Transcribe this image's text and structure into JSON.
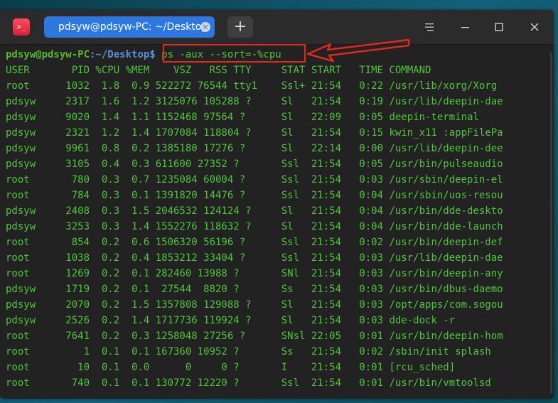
{
  "window": {
    "app_icon_glyph": ">_",
    "tab_title": "pdsyw@pdsyw-PC: ~/Desktop",
    "tab_close_glyph": "×",
    "add_tab_glyph": "+",
    "icons": [
      "terminal-app-icon",
      "close-tab-icon",
      "plus-icon",
      "menu-icon",
      "minimize-icon",
      "maximize-icon",
      "close-icon"
    ]
  },
  "terminal": {
    "prompt_user": "pdsyw@pdsyw-PC",
    "prompt_path": ":~/Desktop$",
    "command": " ps -aux --sort=-%cpu",
    "highlight_color": "#e0281f",
    "header": "USER       PID %CPU %MEM    VSZ   RSS TTY     STAT START   TIME COMMAND",
    "rows": [
      "root      1032  1.8  0.9 522272 76544 tty1    Ssl+ 21:54   0:22 /usr/lib/xorg/Xorg",
      "pdsyw     2317  1.6  1.2 3125076 105288 ?     Sl   21:54   0:19 /usr/lib/deepin-dae",
      "pdsyw     9020  1.4  1.1 1152468 97564 ?      Sl   22:09   0:05 deepin-terminal",
      "pdsyw     2321  1.2  1.4 1707084 118804 ?     Sl   21:54   0:15 kwin_x11 :appFilePa",
      "pdsyw     9961  0.8  0.2 1385180 17276 ?      Sl   22:14   0:00 /usr/lib/deepin-dee",
      "pdsyw     3105  0.4  0.3 611600 27352 ?       Ssl  21:54   0:05 /usr/bin/pulseaudio",
      "root       780  0.3  0.7 1235084 60004 ?      Ssl  21:54   0:03 /usr/sbin/deepin-el",
      "root       784  0.3  0.1 1391820 14476 ?      Ssl  21:54   0:04 /usr/sbin/uos-resou",
      "pdsyw     2408  0.3  1.5 2046532 124124 ?     Sl   21:54   0:04 /usr/bin/dde-deskto",
      "pdsyw     3253  0.3  1.4 1552276 118632 ?     Sl   21:54   0:04 /usr/bin/dde-launch",
      "root       854  0.2  0.6 1506320 56196 ?      Ssl  21:54   0:02 /usr/bin/deepin-def",
      "root      1038  0.2  0.4 1853212 33404 ?      Ssl  21:54   0:03 /usr/lib/deepin-dae",
      "root      1269  0.2  0.1 282460 13988 ?       SNl  21:54   0:03 /usr/bin/deepin-any",
      "pdsyw     1719  0.2  0.1  27544  8820 ?       Ss   21:54   0:03 /usr/bin/dbus-daemo",
      "pdsyw     2070  0.2  1.5 1357808 129088 ?     Sl   21:54   0:03 /opt/apps/com.sogou",
      "pdsyw     2526  0.2  1.4 1717736 119924 ?     Sl   21:54   0:03 dde-dock -r",
      "root      7641  0.2  0.3 1258048 27256 ?      SNsl 22:05   0:01 /usr/bin/deepin-hom",
      "root         1  0.1  0.1 167360 10952 ?       Ss   21:54   0:02 /sbin/init splash",
      "root        10  0.1  0.0      0     0 ?       I    21:54   0:01 [rcu_sched]",
      "root       740  0.1  0.1 130772 12220 ?       Ssl  21:54   0:01 /usr/bin/vmtoolsd"
    ]
  }
}
